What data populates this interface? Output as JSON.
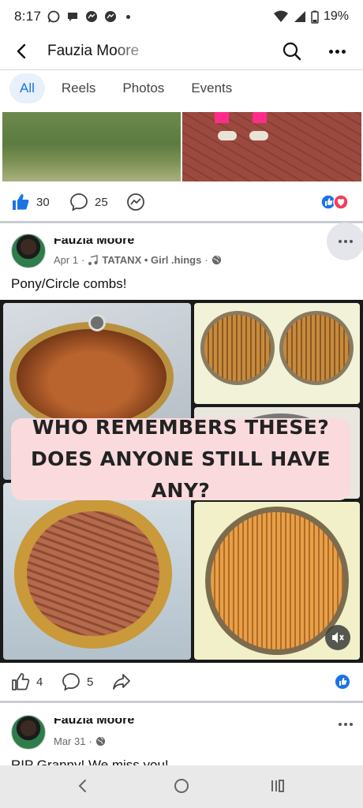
{
  "status_bar": {
    "time": "8:17",
    "battery": "19%"
  },
  "header": {
    "title": "Fauzia Moore"
  },
  "tabs": [
    {
      "label": "All",
      "active": true
    },
    {
      "label": "Reels",
      "active": false
    },
    {
      "label": "Photos",
      "active": false
    },
    {
      "label": "Events",
      "active": false
    }
  ],
  "post1_stats": {
    "likes": "30",
    "comments": "25"
  },
  "post2": {
    "author": "Fauzia Moore",
    "date": "Apr 1",
    "music": "TATANX • Girl Things",
    "music_display": "TATANX • Girl .hings",
    "text": "Pony/Circle combs!",
    "image_caption": "WHO REMEMBERS THESE? DOES ANYONE STILL HAVE ANY?",
    "likes": "4",
    "comments": "5"
  },
  "post3": {
    "author": "Fauzia Moore",
    "date": "Mar 31",
    "text": "RIP Granny! We miss you!"
  },
  "colors": {
    "accent": "#1b74e4",
    "tab_active_bg": "#e7f0fb",
    "caption_bg": "#fadadd",
    "love": "#f33e58"
  },
  "icons": [
    "back-icon",
    "search-icon",
    "more-icon",
    "like-icon",
    "comment-icon",
    "messenger-icon",
    "share-icon",
    "globe-icon",
    "music-icon",
    "mute-icon",
    "nav-back-icon",
    "nav-home-icon",
    "nav-recents-icon"
  ]
}
